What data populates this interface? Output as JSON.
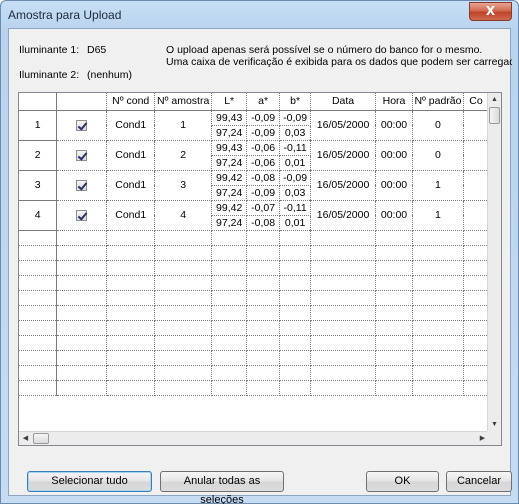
{
  "window": {
    "title": "Amostra para Upload",
    "close_glyph": "X"
  },
  "info": {
    "illuminant1_label": "Iluminante 1:",
    "illuminant1_value": "D65",
    "illuminant2_label": "Iluminante 2:",
    "illuminant2_value": "(nenhum)",
    "message_line1": "O upload apenas será possível se o número do banco for o mesmo.",
    "message_line2": "Uma caixa de verificação é exibida para os dados que podem ser carregados."
  },
  "table": {
    "columns": [
      "",
      "",
      "Nº cond",
      "Nº amostra",
      "L*",
      "a*",
      "b*",
      "Data",
      "Hora",
      "Nº padrão",
      "Co"
    ],
    "rows": [
      {
        "num": "1",
        "checked": true,
        "cond": "Cond1",
        "amostra": "1",
        "L": [
          "99,43",
          "97,24"
        ],
        "a": [
          "-0,09",
          "-0,09"
        ],
        "b": [
          "-0,09",
          "0,03"
        ],
        "data": "16/05/2000",
        "hora": "00:00",
        "padrao": "0"
      },
      {
        "num": "2",
        "checked": true,
        "cond": "Cond1",
        "amostra": "2",
        "L": [
          "99,43",
          "97,24"
        ],
        "a": [
          "-0,06",
          "-0,06"
        ],
        "b": [
          "-0,11",
          "0,01"
        ],
        "data": "16/05/2000",
        "hora": "00:00",
        "padrao": "0"
      },
      {
        "num": "3",
        "checked": true,
        "cond": "Cond1",
        "amostra": "3",
        "L": [
          "99,42",
          "97,24"
        ],
        "a": [
          "-0,08",
          "-0,09"
        ],
        "b": [
          "-0,09",
          "0,03"
        ],
        "data": "16/05/2000",
        "hora": "00:00",
        "padrao": "1"
      },
      {
        "num": "4",
        "checked": true,
        "cond": "Cond1",
        "amostra": "4",
        "L": [
          "99,42",
          "97,24"
        ],
        "a": [
          "-0,07",
          "-0,08"
        ],
        "b": [
          "-0,11",
          "0,01"
        ],
        "data": "16/05/2000",
        "hora": "00:00",
        "padrao": "1"
      }
    ],
    "empty_row_count": 11
  },
  "scrollbars": {
    "up": "▲",
    "down": "▼",
    "left": "◀",
    "right": "▶"
  },
  "buttons": {
    "select_all": "Selecionar tudo",
    "clear_all": "Anular todas as seleções",
    "ok": "OK",
    "cancel": "Cancelar"
  }
}
